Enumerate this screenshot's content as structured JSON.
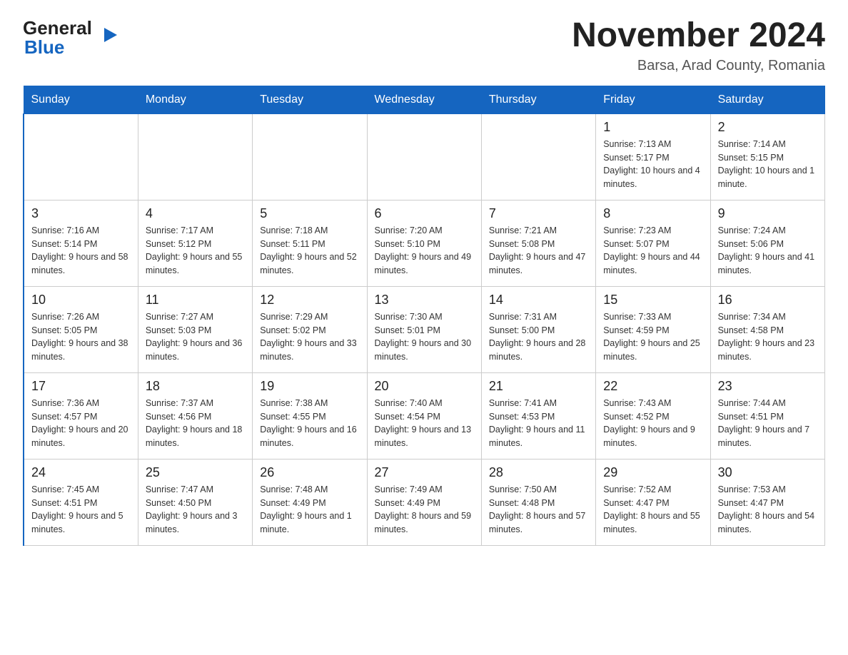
{
  "header": {
    "logo_general": "General",
    "logo_blue": "Blue",
    "title_month": "November 2024",
    "title_location": "Barsa, Arad County, Romania"
  },
  "days_of_week": [
    "Sunday",
    "Monday",
    "Tuesday",
    "Wednesday",
    "Thursday",
    "Friday",
    "Saturday"
  ],
  "weeks": [
    {
      "cells": [
        {
          "day": "",
          "info": "",
          "empty": true
        },
        {
          "day": "",
          "info": "",
          "empty": true
        },
        {
          "day": "",
          "info": "",
          "empty": true
        },
        {
          "day": "",
          "info": "",
          "empty": true
        },
        {
          "day": "",
          "info": "",
          "empty": true
        },
        {
          "day": "1",
          "info": "Sunrise: 7:13 AM\nSunset: 5:17 PM\nDaylight: 10 hours and 4 minutes.",
          "empty": false
        },
        {
          "day": "2",
          "info": "Sunrise: 7:14 AM\nSunset: 5:15 PM\nDaylight: 10 hours and 1 minute.",
          "empty": false
        }
      ]
    },
    {
      "cells": [
        {
          "day": "3",
          "info": "Sunrise: 7:16 AM\nSunset: 5:14 PM\nDaylight: 9 hours and 58 minutes.",
          "empty": false
        },
        {
          "day": "4",
          "info": "Sunrise: 7:17 AM\nSunset: 5:12 PM\nDaylight: 9 hours and 55 minutes.",
          "empty": false
        },
        {
          "day": "5",
          "info": "Sunrise: 7:18 AM\nSunset: 5:11 PM\nDaylight: 9 hours and 52 minutes.",
          "empty": false
        },
        {
          "day": "6",
          "info": "Sunrise: 7:20 AM\nSunset: 5:10 PM\nDaylight: 9 hours and 49 minutes.",
          "empty": false
        },
        {
          "day": "7",
          "info": "Sunrise: 7:21 AM\nSunset: 5:08 PM\nDaylight: 9 hours and 47 minutes.",
          "empty": false
        },
        {
          "day": "8",
          "info": "Sunrise: 7:23 AM\nSunset: 5:07 PM\nDaylight: 9 hours and 44 minutes.",
          "empty": false
        },
        {
          "day": "9",
          "info": "Sunrise: 7:24 AM\nSunset: 5:06 PM\nDaylight: 9 hours and 41 minutes.",
          "empty": false
        }
      ]
    },
    {
      "cells": [
        {
          "day": "10",
          "info": "Sunrise: 7:26 AM\nSunset: 5:05 PM\nDaylight: 9 hours and 38 minutes.",
          "empty": false
        },
        {
          "day": "11",
          "info": "Sunrise: 7:27 AM\nSunset: 5:03 PM\nDaylight: 9 hours and 36 minutes.",
          "empty": false
        },
        {
          "day": "12",
          "info": "Sunrise: 7:29 AM\nSunset: 5:02 PM\nDaylight: 9 hours and 33 minutes.",
          "empty": false
        },
        {
          "day": "13",
          "info": "Sunrise: 7:30 AM\nSunset: 5:01 PM\nDaylight: 9 hours and 30 minutes.",
          "empty": false
        },
        {
          "day": "14",
          "info": "Sunrise: 7:31 AM\nSunset: 5:00 PM\nDaylight: 9 hours and 28 minutes.",
          "empty": false
        },
        {
          "day": "15",
          "info": "Sunrise: 7:33 AM\nSunset: 4:59 PM\nDaylight: 9 hours and 25 minutes.",
          "empty": false
        },
        {
          "day": "16",
          "info": "Sunrise: 7:34 AM\nSunset: 4:58 PM\nDaylight: 9 hours and 23 minutes.",
          "empty": false
        }
      ]
    },
    {
      "cells": [
        {
          "day": "17",
          "info": "Sunrise: 7:36 AM\nSunset: 4:57 PM\nDaylight: 9 hours and 20 minutes.",
          "empty": false
        },
        {
          "day": "18",
          "info": "Sunrise: 7:37 AM\nSunset: 4:56 PM\nDaylight: 9 hours and 18 minutes.",
          "empty": false
        },
        {
          "day": "19",
          "info": "Sunrise: 7:38 AM\nSunset: 4:55 PM\nDaylight: 9 hours and 16 minutes.",
          "empty": false
        },
        {
          "day": "20",
          "info": "Sunrise: 7:40 AM\nSunset: 4:54 PM\nDaylight: 9 hours and 13 minutes.",
          "empty": false
        },
        {
          "day": "21",
          "info": "Sunrise: 7:41 AM\nSunset: 4:53 PM\nDaylight: 9 hours and 11 minutes.",
          "empty": false
        },
        {
          "day": "22",
          "info": "Sunrise: 7:43 AM\nSunset: 4:52 PM\nDaylight: 9 hours and 9 minutes.",
          "empty": false
        },
        {
          "day": "23",
          "info": "Sunrise: 7:44 AM\nSunset: 4:51 PM\nDaylight: 9 hours and 7 minutes.",
          "empty": false
        }
      ]
    },
    {
      "cells": [
        {
          "day": "24",
          "info": "Sunrise: 7:45 AM\nSunset: 4:51 PM\nDaylight: 9 hours and 5 minutes.",
          "empty": false
        },
        {
          "day": "25",
          "info": "Sunrise: 7:47 AM\nSunset: 4:50 PM\nDaylight: 9 hours and 3 minutes.",
          "empty": false
        },
        {
          "day": "26",
          "info": "Sunrise: 7:48 AM\nSunset: 4:49 PM\nDaylight: 9 hours and 1 minute.",
          "empty": false
        },
        {
          "day": "27",
          "info": "Sunrise: 7:49 AM\nSunset: 4:49 PM\nDaylight: 8 hours and 59 minutes.",
          "empty": false
        },
        {
          "day": "28",
          "info": "Sunrise: 7:50 AM\nSunset: 4:48 PM\nDaylight: 8 hours and 57 minutes.",
          "empty": false
        },
        {
          "day": "29",
          "info": "Sunrise: 7:52 AM\nSunset: 4:47 PM\nDaylight: 8 hours and 55 minutes.",
          "empty": false
        },
        {
          "day": "30",
          "info": "Sunrise: 7:53 AM\nSunset: 4:47 PM\nDaylight: 8 hours and 54 minutes.",
          "empty": false
        }
      ]
    }
  ]
}
